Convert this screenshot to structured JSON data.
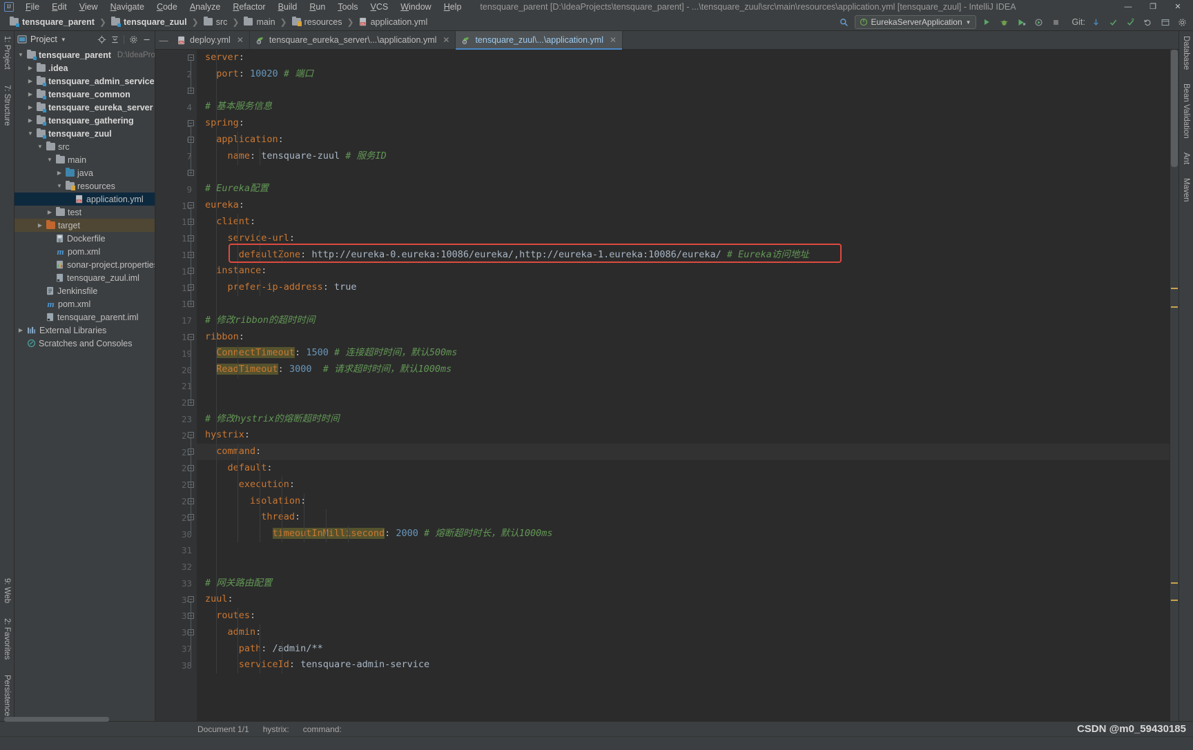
{
  "window": {
    "title": "tensquare_parent [D:\\IdeaProjects\\tensquare_parent] - ...\\tensquare_zuul\\src\\main\\resources\\application.yml [tensquare_zuul] - IntelliJ IDEA",
    "minimize": "—",
    "maximize": "❐",
    "close": "✕"
  },
  "menu": [
    "File",
    "Edit",
    "View",
    "Navigate",
    "Code",
    "Analyze",
    "Refactor",
    "Build",
    "Run",
    "Tools",
    "VCS",
    "Window",
    "Help"
  ],
  "breadcrumb": [
    {
      "label": "tensquare_parent",
      "icon": "module-icon",
      "bold": true
    },
    {
      "label": "tensquare_zuul",
      "icon": "module-icon",
      "bold": true
    },
    {
      "label": "src",
      "icon": "folder-icon",
      "bold": false
    },
    {
      "label": "main",
      "icon": "folder-icon",
      "bold": false
    },
    {
      "label": "resources",
      "icon": "resources-folder-icon",
      "bold": false
    },
    {
      "label": "application.yml",
      "icon": "yml-file-icon",
      "bold": false
    }
  ],
  "nav_right": {
    "search_icon": "search-icon",
    "run_config": "EurekaServerApplication",
    "run_icon": "run-icon",
    "debug_icon": "debug-icon",
    "coverage_icon": "coverage-icon",
    "profile_icon": "profile-icon",
    "stop_icon": "stop-icon",
    "git_label": "Git:",
    "git_update_icon": "update-project-icon",
    "git_commit_icon": "commit-icon",
    "git_push_icon": "push-icon",
    "git_rollback_icon": "rollback-icon",
    "search_everywhere_icon": "search-everywhere-icon",
    "settings_icon": "settings-gear-icon"
  },
  "left_rail": {
    "top": [
      "1: Project",
      "7: Structure"
    ],
    "bottom": [
      "9: Web",
      "2: Favorites",
      "Persistence"
    ]
  },
  "right_rail": [
    "Database",
    "Bean Validation",
    "Ant",
    "Maven"
  ],
  "project_panel": {
    "title": "Project",
    "dropdown_icon": "chevron-down-icon",
    "actions": [
      "locate-icon",
      "collapse-all-icon",
      "settings-gear-icon",
      "hide-icon"
    ],
    "tree": [
      {
        "label": "tensquare_parent",
        "suffix": "D:\\IdeaProje",
        "depth": 0,
        "arrow": "down",
        "icon": "module-icon",
        "bold": true,
        "state": "none"
      },
      {
        "label": ".idea",
        "suffix": "",
        "depth": 1,
        "arrow": "right",
        "icon": "folder-icon",
        "bold": true,
        "state": "none"
      },
      {
        "label": "tensquare_admin_service",
        "suffix": "",
        "depth": 1,
        "arrow": "right",
        "icon": "module-icon",
        "bold": true,
        "state": "none"
      },
      {
        "label": "tensquare_common",
        "suffix": "",
        "depth": 1,
        "arrow": "right",
        "icon": "module-icon",
        "bold": true,
        "state": "none"
      },
      {
        "label": "tensquare_eureka_server",
        "suffix": "",
        "depth": 1,
        "arrow": "right",
        "icon": "module-icon",
        "bold": true,
        "state": "none"
      },
      {
        "label": "tensquare_gathering",
        "suffix": "",
        "depth": 1,
        "arrow": "right",
        "icon": "module-icon",
        "bold": true,
        "state": "none"
      },
      {
        "label": "tensquare_zuul",
        "suffix": "",
        "depth": 1,
        "arrow": "down",
        "icon": "module-icon",
        "bold": true,
        "state": "none"
      },
      {
        "label": "src",
        "suffix": "",
        "depth": 2,
        "arrow": "down",
        "icon": "folder-icon",
        "bold": false,
        "state": "none"
      },
      {
        "label": "main",
        "suffix": "",
        "depth": 3,
        "arrow": "down",
        "icon": "folder-icon",
        "bold": false,
        "state": "none"
      },
      {
        "label": "java",
        "suffix": "",
        "depth": 4,
        "arrow": "right",
        "icon": "sources-folder-icon",
        "bold": false,
        "state": "none"
      },
      {
        "label": "resources",
        "suffix": "",
        "depth": 4,
        "arrow": "down",
        "icon": "resources-folder-icon",
        "bold": false,
        "state": "none"
      },
      {
        "label": "application.yml",
        "suffix": "",
        "depth": 5,
        "arrow": "none",
        "icon": "yml-file-icon",
        "bold": false,
        "state": "selected"
      },
      {
        "label": "test",
        "suffix": "",
        "depth": 3,
        "arrow": "right",
        "icon": "folder-icon",
        "bold": false,
        "state": "none"
      },
      {
        "label": "target",
        "suffix": "",
        "depth": 2,
        "arrow": "right",
        "icon": "excluded-folder-icon",
        "bold": false,
        "state": "highlight"
      },
      {
        "label": "Dockerfile",
        "suffix": "",
        "depth": 3,
        "arrow": "none",
        "icon": "docker-file-icon",
        "bold": false,
        "state": "none"
      },
      {
        "label": "pom.xml",
        "suffix": "",
        "depth": 3,
        "arrow": "none",
        "icon": "maven-file-icon",
        "bold": false,
        "state": "none"
      },
      {
        "label": "sonar-project.properties",
        "suffix": "",
        "depth": 3,
        "arrow": "none",
        "icon": "properties-file-icon",
        "bold": false,
        "state": "none"
      },
      {
        "label": "tensquare_zuul.iml",
        "suffix": "",
        "depth": 3,
        "arrow": "none",
        "icon": "iml-file-icon",
        "bold": false,
        "state": "none"
      },
      {
        "label": "Jenkinsfile",
        "suffix": "",
        "depth": 2,
        "arrow": "none",
        "icon": "text-file-icon",
        "bold": false,
        "state": "none"
      },
      {
        "label": "pom.xml",
        "suffix": "",
        "depth": 2,
        "arrow": "none",
        "icon": "maven-file-icon",
        "bold": false,
        "state": "none"
      },
      {
        "label": "tensquare_parent.iml",
        "suffix": "",
        "depth": 2,
        "arrow": "none",
        "icon": "iml-file-icon",
        "bold": false,
        "state": "none"
      },
      {
        "label": "External Libraries",
        "suffix": "",
        "depth": 0,
        "arrow": "right",
        "icon": "libraries-icon",
        "bold": false,
        "state": "none"
      },
      {
        "label": "Scratches and Consoles",
        "suffix": "",
        "depth": 0,
        "arrow": "none",
        "icon": "scratches-icon",
        "bold": false,
        "state": "none"
      }
    ]
  },
  "editor_tabs": [
    {
      "label": "deploy.yml",
      "icon": "yml-file-icon",
      "active": false,
      "closable": true
    },
    {
      "label": "tensquare_eureka_server\\...\\application.yml",
      "icon": "yml-spring-icon",
      "active": false,
      "closable": true
    },
    {
      "label": "tensquare_zuul\\...\\application.yml",
      "icon": "yml-spring-icon",
      "active": true,
      "closable": true
    }
  ],
  "code": {
    "lines": [
      {
        "n": 1,
        "indent": 0,
        "fold": "start",
        "tokens": [
          {
            "t": "server",
            "c": "k"
          },
          {
            "t": ":",
            "c": "p"
          }
        ]
      },
      {
        "n": 2,
        "indent": 1,
        "fold": "",
        "tokens": [
          {
            "t": "  port",
            "c": "k"
          },
          {
            "t": ": ",
            "c": "p"
          },
          {
            "t": "10020",
            "c": "num"
          },
          {
            "t": " # 端口",
            "c": "cm"
          }
        ]
      },
      {
        "n": 3,
        "indent": 0,
        "fold": "end",
        "tokens": []
      },
      {
        "n": 4,
        "indent": 0,
        "fold": "",
        "tokens": [
          {
            "t": "# 基本服务信息",
            "c": "cm"
          }
        ]
      },
      {
        "n": 5,
        "indent": 0,
        "fold": "start",
        "tokens": [
          {
            "t": "spring",
            "c": "k"
          },
          {
            "t": ":",
            "c": "p"
          }
        ]
      },
      {
        "n": 6,
        "indent": 1,
        "fold": "start",
        "tokens": [
          {
            "t": "  application",
            "c": "k"
          },
          {
            "t": ":",
            "c": "p"
          }
        ]
      },
      {
        "n": 7,
        "indent": 2,
        "fold": "",
        "tokens": [
          {
            "t": "    name",
            "c": "k"
          },
          {
            "t": ": ",
            "c": "p"
          },
          {
            "t": "tensquare-zuul",
            "c": "val"
          },
          {
            "t": " # 服务ID",
            "c": "cm"
          }
        ]
      },
      {
        "n": 8,
        "indent": 0,
        "fold": "end",
        "tokens": []
      },
      {
        "n": 9,
        "indent": 0,
        "fold": "",
        "tokens": [
          {
            "t": "# Eureka配置",
            "c": "cm"
          }
        ]
      },
      {
        "n": 10,
        "indent": 0,
        "fold": "start",
        "tokens": [
          {
            "t": "eureka",
            "c": "k"
          },
          {
            "t": ":",
            "c": "p"
          }
        ]
      },
      {
        "n": 11,
        "indent": 1,
        "fold": "start",
        "tokens": [
          {
            "t": "  client",
            "c": "k"
          },
          {
            "t": ":",
            "c": "p"
          }
        ]
      },
      {
        "n": 12,
        "indent": 2,
        "fold": "start",
        "tokens": [
          {
            "t": "    service-url",
            "c": "k"
          },
          {
            "t": ":",
            "c": "p"
          }
        ]
      },
      {
        "n": 13,
        "indent": 3,
        "fold": "end",
        "tokens": [
          {
            "t": "      defaultZone",
            "c": "k"
          },
          {
            "t": ": ",
            "c": "p"
          },
          {
            "t": "http://eureka-0.eureka:10086/eureka/,http://eureka-1.eureka:10086/eureka/",
            "c": "val"
          },
          {
            "t": " # Eureka访问地址",
            "c": "cm"
          }
        ]
      },
      {
        "n": 14,
        "indent": 1,
        "fold": "start",
        "tokens": [
          {
            "t": "  instance",
            "c": "k"
          },
          {
            "t": ":",
            "c": "p"
          }
        ]
      },
      {
        "n": 15,
        "indent": 2,
        "fold": "end",
        "tokens": [
          {
            "t": "    prefer-ip-address",
            "c": "k"
          },
          {
            "t": ": ",
            "c": "p"
          },
          {
            "t": "true",
            "c": "val"
          }
        ]
      },
      {
        "n": 16,
        "indent": 0,
        "fold": "end",
        "tokens": []
      },
      {
        "n": 17,
        "indent": 0,
        "fold": "",
        "tokens": [
          {
            "t": "# 修改ribbon的超时时间",
            "c": "cm"
          }
        ]
      },
      {
        "n": 18,
        "indent": 0,
        "fold": "start",
        "tokens": [
          {
            "t": "ribbon",
            "c": "k"
          },
          {
            "t": ":",
            "c": "p"
          }
        ]
      },
      {
        "n": 19,
        "indent": 1,
        "fold": "",
        "tokens": [
          {
            "t": "  ",
            "c": "p"
          },
          {
            "t": "ConnectTimeout",
            "c": "k hl"
          },
          {
            "t": ": ",
            "c": "p"
          },
          {
            "t": "1500",
            "c": "num"
          },
          {
            "t": " # 连接超时时间，默认500ms",
            "c": "cm"
          }
        ]
      },
      {
        "n": 20,
        "indent": 1,
        "fold": "",
        "tokens": [
          {
            "t": "  ",
            "c": "p"
          },
          {
            "t": "ReadTimeout",
            "c": "k hl"
          },
          {
            "t": ": ",
            "c": "p"
          },
          {
            "t": "3000",
            "c": "num"
          },
          {
            "t": "  # 请求超时时间，默认1000ms",
            "c": "cm"
          }
        ]
      },
      {
        "n": 21,
        "indent": 0,
        "fold": "",
        "tokens": []
      },
      {
        "n": 22,
        "indent": 0,
        "fold": "end",
        "tokens": []
      },
      {
        "n": 23,
        "indent": 0,
        "fold": "",
        "tokens": [
          {
            "t": "# 修改hystrix的熔断超时时间",
            "c": "cm"
          }
        ]
      },
      {
        "n": 24,
        "indent": 0,
        "fold": "start",
        "tokens": [
          {
            "t": "hystrix",
            "c": "k"
          },
          {
            "t": ":",
            "c": "p"
          }
        ]
      },
      {
        "n": 25,
        "indent": 1,
        "fold": "start",
        "caret": true,
        "tokens": [
          {
            "t": "  command",
            "c": "k"
          },
          {
            "t": ":",
            "c": "p"
          }
        ]
      },
      {
        "n": 26,
        "indent": 2,
        "fold": "start",
        "tokens": [
          {
            "t": "    default",
            "c": "k"
          },
          {
            "t": ":",
            "c": "p"
          }
        ]
      },
      {
        "n": 27,
        "indent": 3,
        "fold": "start",
        "tokens": [
          {
            "t": "      execution",
            "c": "k"
          },
          {
            "t": ":",
            "c": "p"
          }
        ]
      },
      {
        "n": 28,
        "indent": 4,
        "fold": "start",
        "tokens": [
          {
            "t": "        isolation",
            "c": "k"
          },
          {
            "t": ":",
            "c": "p"
          }
        ]
      },
      {
        "n": 29,
        "indent": 5,
        "fold": "start",
        "tokens": [
          {
            "t": "          thread",
            "c": "k"
          },
          {
            "t": ":",
            "c": "p"
          }
        ]
      },
      {
        "n": 30,
        "indent": 6,
        "fold": "",
        "tokens": [
          {
            "t": "            ",
            "c": "p"
          },
          {
            "t": "timeoutInMillisecond",
            "c": "k hl"
          },
          {
            "t": ": ",
            "c": "p"
          },
          {
            "t": "2000",
            "c": "num"
          },
          {
            "t": " # 熔断超时时长，默认1000ms",
            "c": "cm"
          }
        ]
      },
      {
        "n": 31,
        "indent": 0,
        "fold": "",
        "tokens": []
      },
      {
        "n": 32,
        "indent": 0,
        "fold": "",
        "tokens": []
      },
      {
        "n": 33,
        "indent": 0,
        "fold": "",
        "tokens": [
          {
            "t": "# 网关路由配置",
            "c": "cm"
          }
        ]
      },
      {
        "n": 34,
        "indent": 0,
        "fold": "start",
        "tokens": [
          {
            "t": "zuul",
            "c": "k"
          },
          {
            "t": ":",
            "c": "p"
          }
        ]
      },
      {
        "n": 35,
        "indent": 1,
        "fold": "start",
        "tokens": [
          {
            "t": "  routes",
            "c": "k"
          },
          {
            "t": ":",
            "c": "p"
          }
        ]
      },
      {
        "n": 36,
        "indent": 2,
        "fold": "start",
        "tokens": [
          {
            "t": "    admin",
            "c": "k"
          },
          {
            "t": ":",
            "c": "p"
          }
        ]
      },
      {
        "n": 37,
        "indent": 3,
        "fold": "",
        "tokens": [
          {
            "t": "      path",
            "c": "k"
          },
          {
            "t": ": ",
            "c": "p"
          },
          {
            "t": "/admin/**",
            "c": "val"
          }
        ]
      },
      {
        "n": 38,
        "indent": 3,
        "fold": "",
        "tokens": [
          {
            "t": "      serviceId",
            "c": "k"
          },
          {
            "t": ": ",
            "c": "p"
          },
          {
            "t": "tensquare-admin-service",
            "c": "val"
          }
        ]
      }
    ]
  },
  "annotation": {
    "box_color": "#e04a3f",
    "target_line": 13
  },
  "status_bar": {
    "document": "Document 1/1",
    "breadcrumb_1": "hystrix:",
    "breadcrumb_2": "command:",
    "watermark": "CSDN @m0_59430185"
  }
}
